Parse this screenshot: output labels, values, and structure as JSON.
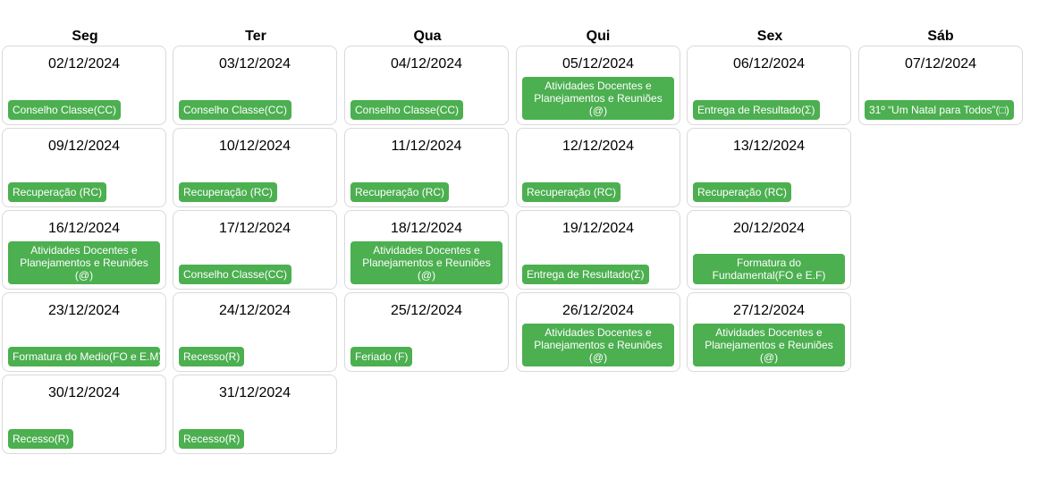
{
  "weekdays": [
    "Seg",
    "Ter",
    "Qua",
    "Qui",
    "Sex",
    "Sáb"
  ],
  "colors": {
    "event_bg": "#4caf50",
    "event_text": "#ffffff",
    "cell_border": "#d9d9d9"
  },
  "weeks": [
    [
      {
        "date": "02/12/2024",
        "event": "Conselho Classe(CC)"
      },
      {
        "date": "03/12/2024",
        "event": "Conselho Classe(CC)"
      },
      {
        "date": "04/12/2024",
        "event": "Conselho Classe(CC)"
      },
      {
        "date": "05/12/2024",
        "event": "Atividades Docentes e Planejamentos e Reuniões (@)"
      },
      {
        "date": "06/12/2024",
        "event": "Entrega de Resultado(Σ)"
      },
      {
        "date": "07/12/2024",
        "event": "31º “Um Natal para Todos”(□)"
      }
    ],
    [
      {
        "date": "09/12/2024",
        "event": "Recuperação (RC)"
      },
      {
        "date": "10/12/2024",
        "event": "Recuperação (RC)"
      },
      {
        "date": "11/12/2024",
        "event": "Recuperação (RC)"
      },
      {
        "date": "12/12/2024",
        "event": "Recuperação (RC)"
      },
      {
        "date": "13/12/2024",
        "event": "Recuperação (RC)"
      }
    ],
    [
      {
        "date": "16/12/2024",
        "event": "Atividades Docentes e Planejamentos e Reuniões (@)"
      },
      {
        "date": "17/12/2024",
        "event": "Conselho Classe(CC)"
      },
      {
        "date": "18/12/2024",
        "event": "Atividades Docentes e Planejamentos e Reuniões (@)"
      },
      {
        "date": "19/12/2024",
        "event": "Entrega de Resultado(Σ)"
      },
      {
        "date": "20/12/2024",
        "event": "Formatura do Fundamental(FO e E.F)"
      }
    ],
    [
      {
        "date": "23/12/2024",
        "event": "Formatura do Medio(FO e E.M)"
      },
      {
        "date": "24/12/2024",
        "event": "Recesso(R)"
      },
      {
        "date": "25/12/2024",
        "event": "Feriado (F)"
      },
      {
        "date": "26/12/2024",
        "event": "Atividades Docentes e Planejamentos e Reuniões (@)"
      },
      {
        "date": "27/12/2024",
        "event": "Atividades Docentes e Planejamentos e Reuniões (@)"
      }
    ],
    [
      {
        "date": "30/12/2024",
        "event": "Recesso(R)"
      },
      {
        "date": "31/12/2024",
        "event": "Recesso(R)"
      }
    ]
  ]
}
